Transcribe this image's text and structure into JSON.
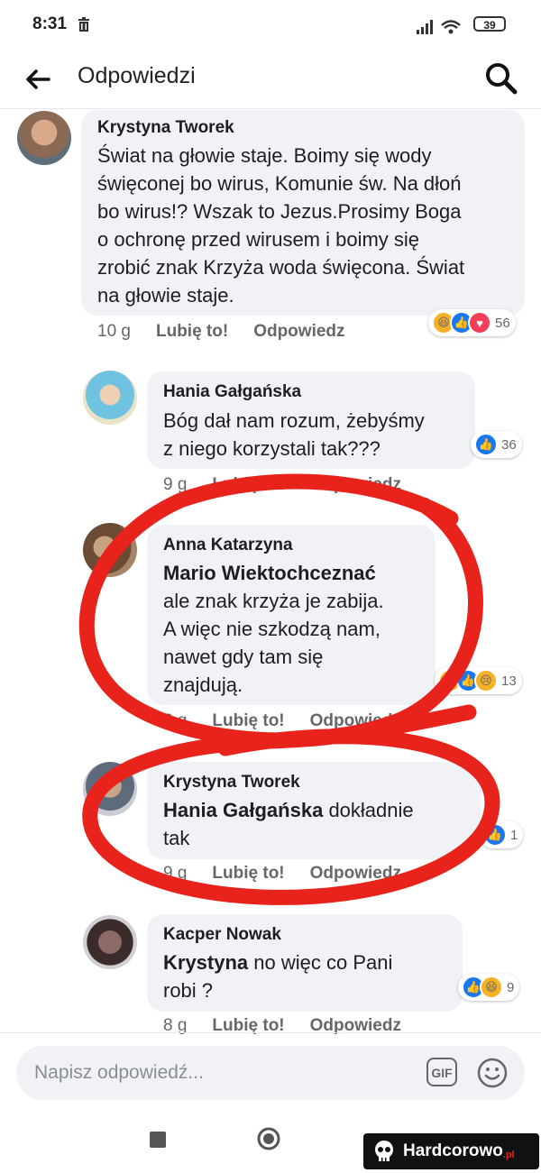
{
  "status": {
    "time": "8:31",
    "battery": "39"
  },
  "header": {
    "title": "Odpowiedzi"
  },
  "comments": [
    {
      "author": "Krystyna Tworek",
      "text": "Świat na głowie staje. Boimy się wody\nświęconej bo wirus, Komunie św. Na dłoń\nbo wirus!? Wszak to Jezus.Prosimy Boga\no ochronę przed wirusem i boimy się\nzrobić znak Krzyża woda święcona. Świat\nna głowie staje.",
      "time": "10 g",
      "like": "Lubię to!",
      "reply": "Odpowiedz",
      "reactions": [
        "haha",
        "like",
        "love"
      ],
      "reaction_count": "56"
    },
    {
      "author": "Hania Gałgańska",
      "text": "Bóg dał nam rozum, żebyśmy\nz niego korzystali tak???",
      "time": "9 g",
      "like": "Lubię to!",
      "reply": "Odpowiedz",
      "reactions": [
        "like"
      ],
      "reaction_count": "36"
    },
    {
      "author": "Anna Katarzyna",
      "mention": "Mario Wiektochceznać",
      "text": "ale znak krzyża je zabija.\nA więc nie szkodzą nam,\nnawet gdy tam się\nznajdują.",
      "time": "6 g",
      "like": "Lubię to!",
      "reply": "Odpowiedz",
      "reactions": [
        "haha",
        "like",
        "sad"
      ],
      "reaction_count": "13"
    },
    {
      "author": "Krystyna Tworek",
      "mention": "Hania Gałgańska",
      "text": "dokładnie\ntak",
      "time": "9 g",
      "like": "Lubię to!",
      "reply": "Odpowiedz",
      "reactions": [
        "like"
      ],
      "reaction_count": "1"
    },
    {
      "author": "Kacper Nowak",
      "mention": "Krystyna",
      "text": "no więc co Pani\nrobi ?",
      "time": "8 g",
      "like": "Lubię to!",
      "reply": "Odpowiedz",
      "reactions": [
        "like",
        "haha"
      ],
      "reaction_count": "9"
    }
  ],
  "composer": {
    "placeholder": "Napisz odpowiedź...",
    "gif_label": "GIF"
  },
  "watermark": {
    "text": "Hardcorowo",
    "suffix": ".pl"
  },
  "colors": {
    "accent": "#1877f2",
    "bubble": "#f0f2f5",
    "circle": "#e8231b"
  }
}
